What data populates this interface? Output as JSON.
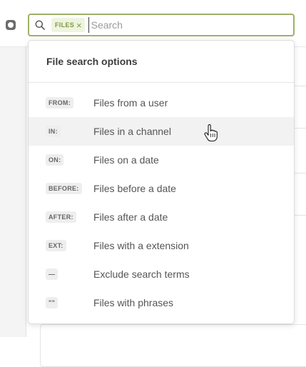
{
  "search": {
    "chip_label": "FILES",
    "chip_close_icon": "close-icon",
    "placeholder": "Search",
    "value": "",
    "border_color": "#9bb265",
    "icon": "search-icon"
  },
  "dropdown": {
    "title": "File search options",
    "options": [
      {
        "tag": "FROM:",
        "label": "Files from a user"
      },
      {
        "tag": "IN:",
        "label": "Files in a channel",
        "hovered": true
      },
      {
        "tag": "ON:",
        "label": "Files on a date"
      },
      {
        "tag": "BEFORE:",
        "label": "Files before a date"
      },
      {
        "tag": "AFTER:",
        "label": "Files after a date"
      },
      {
        "tag": "EXT:",
        "label": "Files with a extension"
      },
      {
        "tag": "—",
        "label": "Exclude search terms"
      },
      {
        "tag": "\"\"",
        "label": "Files with phrases"
      }
    ]
  },
  "colors": {
    "accent": "#9bb265",
    "chip_bg": "#eef4de",
    "hover_bg": "#f2f2f2"
  },
  "cursor": "hand-pointer-icon"
}
